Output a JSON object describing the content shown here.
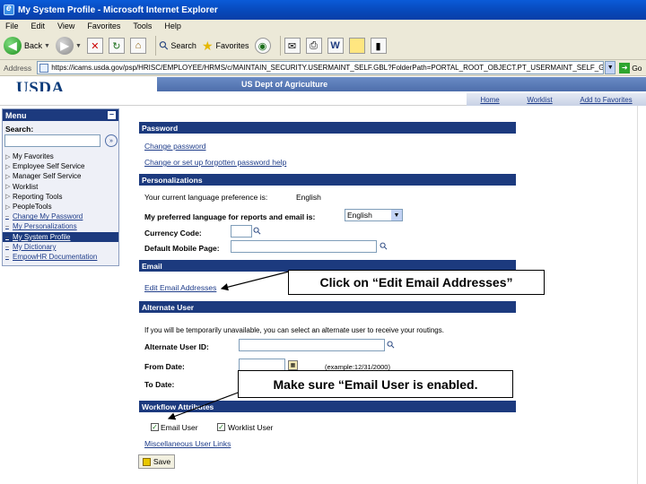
{
  "window": {
    "title": "My System Profile - Microsoft Internet Explorer"
  },
  "menubar": [
    "File",
    "Edit",
    "View",
    "Favorites",
    "Tools",
    "Help"
  ],
  "toolbar": {
    "back": "Back",
    "search": "Search",
    "favorites": "Favorites"
  },
  "address": {
    "label": "Address",
    "url": "https://icams.usda.gov/psp/HRISC/EMPLOYEE/HRMS/c/MAINTAIN_SECURITY.USERMAINT_SELF.GBL?FolderPath=PORTAL_ROOT_OBJECT.PT_USERMAINT_SELF_GBL&IsF",
    "go": "Go"
  },
  "banner": {
    "logo": "USDA",
    "title": "US Dept of Agriculture",
    "nav": [
      "Home",
      "Worklist",
      "Add to Favorites"
    ]
  },
  "menu": {
    "title": "Menu",
    "search_label": "Search:",
    "items": [
      {
        "label": "My Favorites",
        "marker": "▷",
        "link": false
      },
      {
        "label": "Employee Self Service",
        "marker": "▷",
        "link": false
      },
      {
        "label": "Manager Self Service",
        "marker": "▷",
        "link": false
      },
      {
        "label": "Worklist",
        "marker": "▷",
        "link": false
      },
      {
        "label": "Reporting Tools",
        "marker": "▷",
        "link": false
      },
      {
        "label": "PeopleTools",
        "marker": "▷",
        "link": false
      },
      {
        "label": "Change My Password",
        "marker": "–",
        "link": true
      },
      {
        "label": "My Personalizations",
        "marker": "–",
        "link": true
      },
      {
        "label": "My System Profile",
        "marker": "–",
        "link": true,
        "active": true
      },
      {
        "label": "My Dictionary",
        "marker": "–",
        "link": true
      },
      {
        "label": "EmpowHR Documentation",
        "marker": "–",
        "link": true
      }
    ]
  },
  "password": {
    "header": "Password",
    "change": "Change password",
    "forgotten": "Change or set up forgotten password help"
  },
  "personalizations": {
    "header": "Personalizations",
    "current_lang_label": "Your current language preference is:",
    "current_lang_value": "English",
    "preferred_label": "My preferred language for reports and email is:",
    "preferred_value": "English",
    "currency_label": "Currency Code:",
    "mobile_label": "Default Mobile Page:"
  },
  "email": {
    "header": "Email",
    "edit_link": "Edit Email Addresses"
  },
  "alternate": {
    "header": "Alternate User",
    "note": "If you will be temporarily unavailable, you can select an alternate user to receive your routings.",
    "user_id_label": "Alternate User ID:",
    "from_label": "From Date:",
    "to_label": "To Date:",
    "example": "(example:12/31/2000)"
  },
  "workflow": {
    "header": "Workflow Attributes",
    "email_user": "Email User",
    "email_user_checked": true,
    "worklist_user": "Worklist User",
    "worklist_user_checked": true,
    "misc_link": "Miscellaneous User Links"
  },
  "save": "Save",
  "callouts": {
    "email": "Click on “Edit Email Addresses”",
    "enabled": "Make sure “Email User is enabled."
  }
}
